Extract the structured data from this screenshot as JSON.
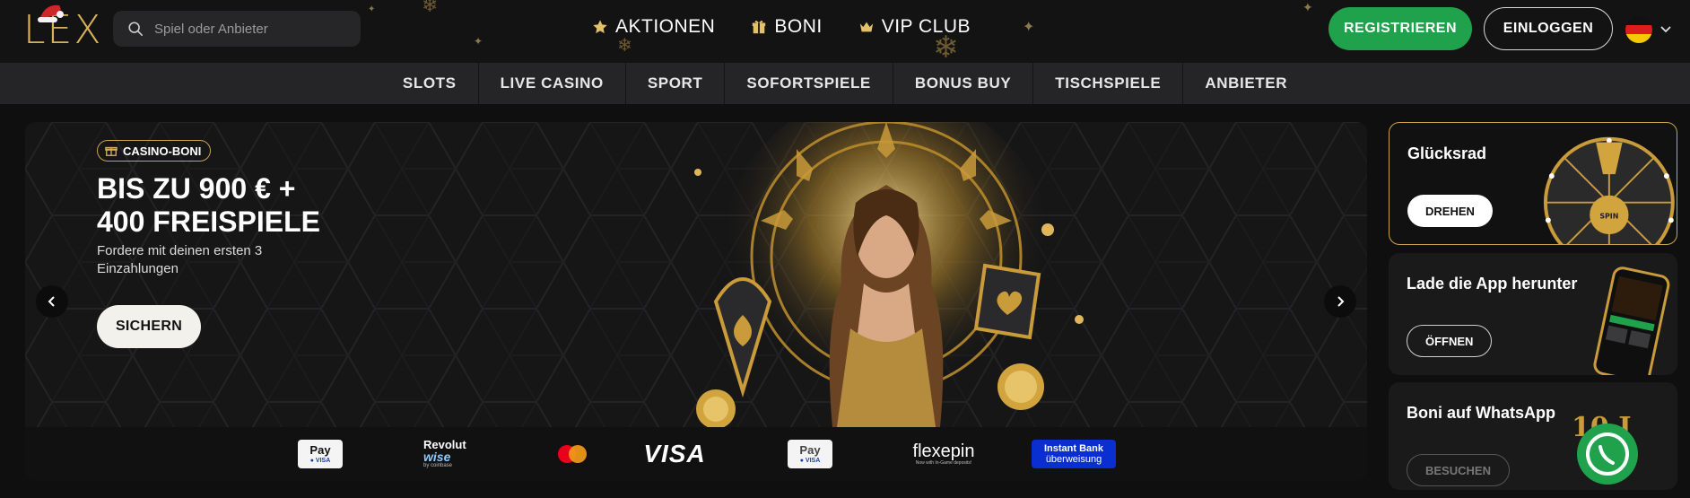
{
  "header": {
    "logo_text": "LEX",
    "search_placeholder": "Spiel oder Anbieter",
    "nav": [
      {
        "label": "AKTIONEN",
        "icon": "star-icon"
      },
      {
        "label": "BONI",
        "icon": "gift-icon"
      },
      {
        "label": "VIP CLUB",
        "icon": "crown-icon"
      }
    ],
    "register_label": "REGISTRIEREN",
    "login_label": "EINLOGGEN",
    "language_flag": "de",
    "accent_color": "#d7b25a",
    "register_color": "#1fa24b"
  },
  "categories": [
    "SLOTS",
    "LIVE CASINO",
    "SPORT",
    "SOFORTSPIELE",
    "BONUS BUY",
    "TISCHSPIELE",
    "ANBIETER"
  ],
  "hero": {
    "badge": "CASINO-BONI",
    "title_line1": "BIS ZU 900 € +",
    "title_line2": "400 FREISPIELE",
    "subtitle": "Fordere mit deinen ersten 3 Einzahlungen",
    "cta_label": "SICHERN"
  },
  "payments": {
    "apple_pay": "Pay",
    "revolut": "Revolut",
    "wise": "wise",
    "coinbase_note": "by coinbase",
    "visa": "VISA",
    "google_pay": "Pay",
    "flexepin": "flexepin",
    "flexepin_note": "Now with In-Game deposits!",
    "instant_bank_line1": "Instant Bank",
    "instant_bank_line2": "überweisung"
  },
  "side_cards": [
    {
      "title": "Glücksrad",
      "button": "DREHEN",
      "spin_label": "SPIN"
    },
    {
      "title": "Lade die App herunter",
      "button": "ÖFFNEN"
    },
    {
      "title": "Boni auf WhatsApp",
      "button": "BESUCHEN"
    }
  ]
}
